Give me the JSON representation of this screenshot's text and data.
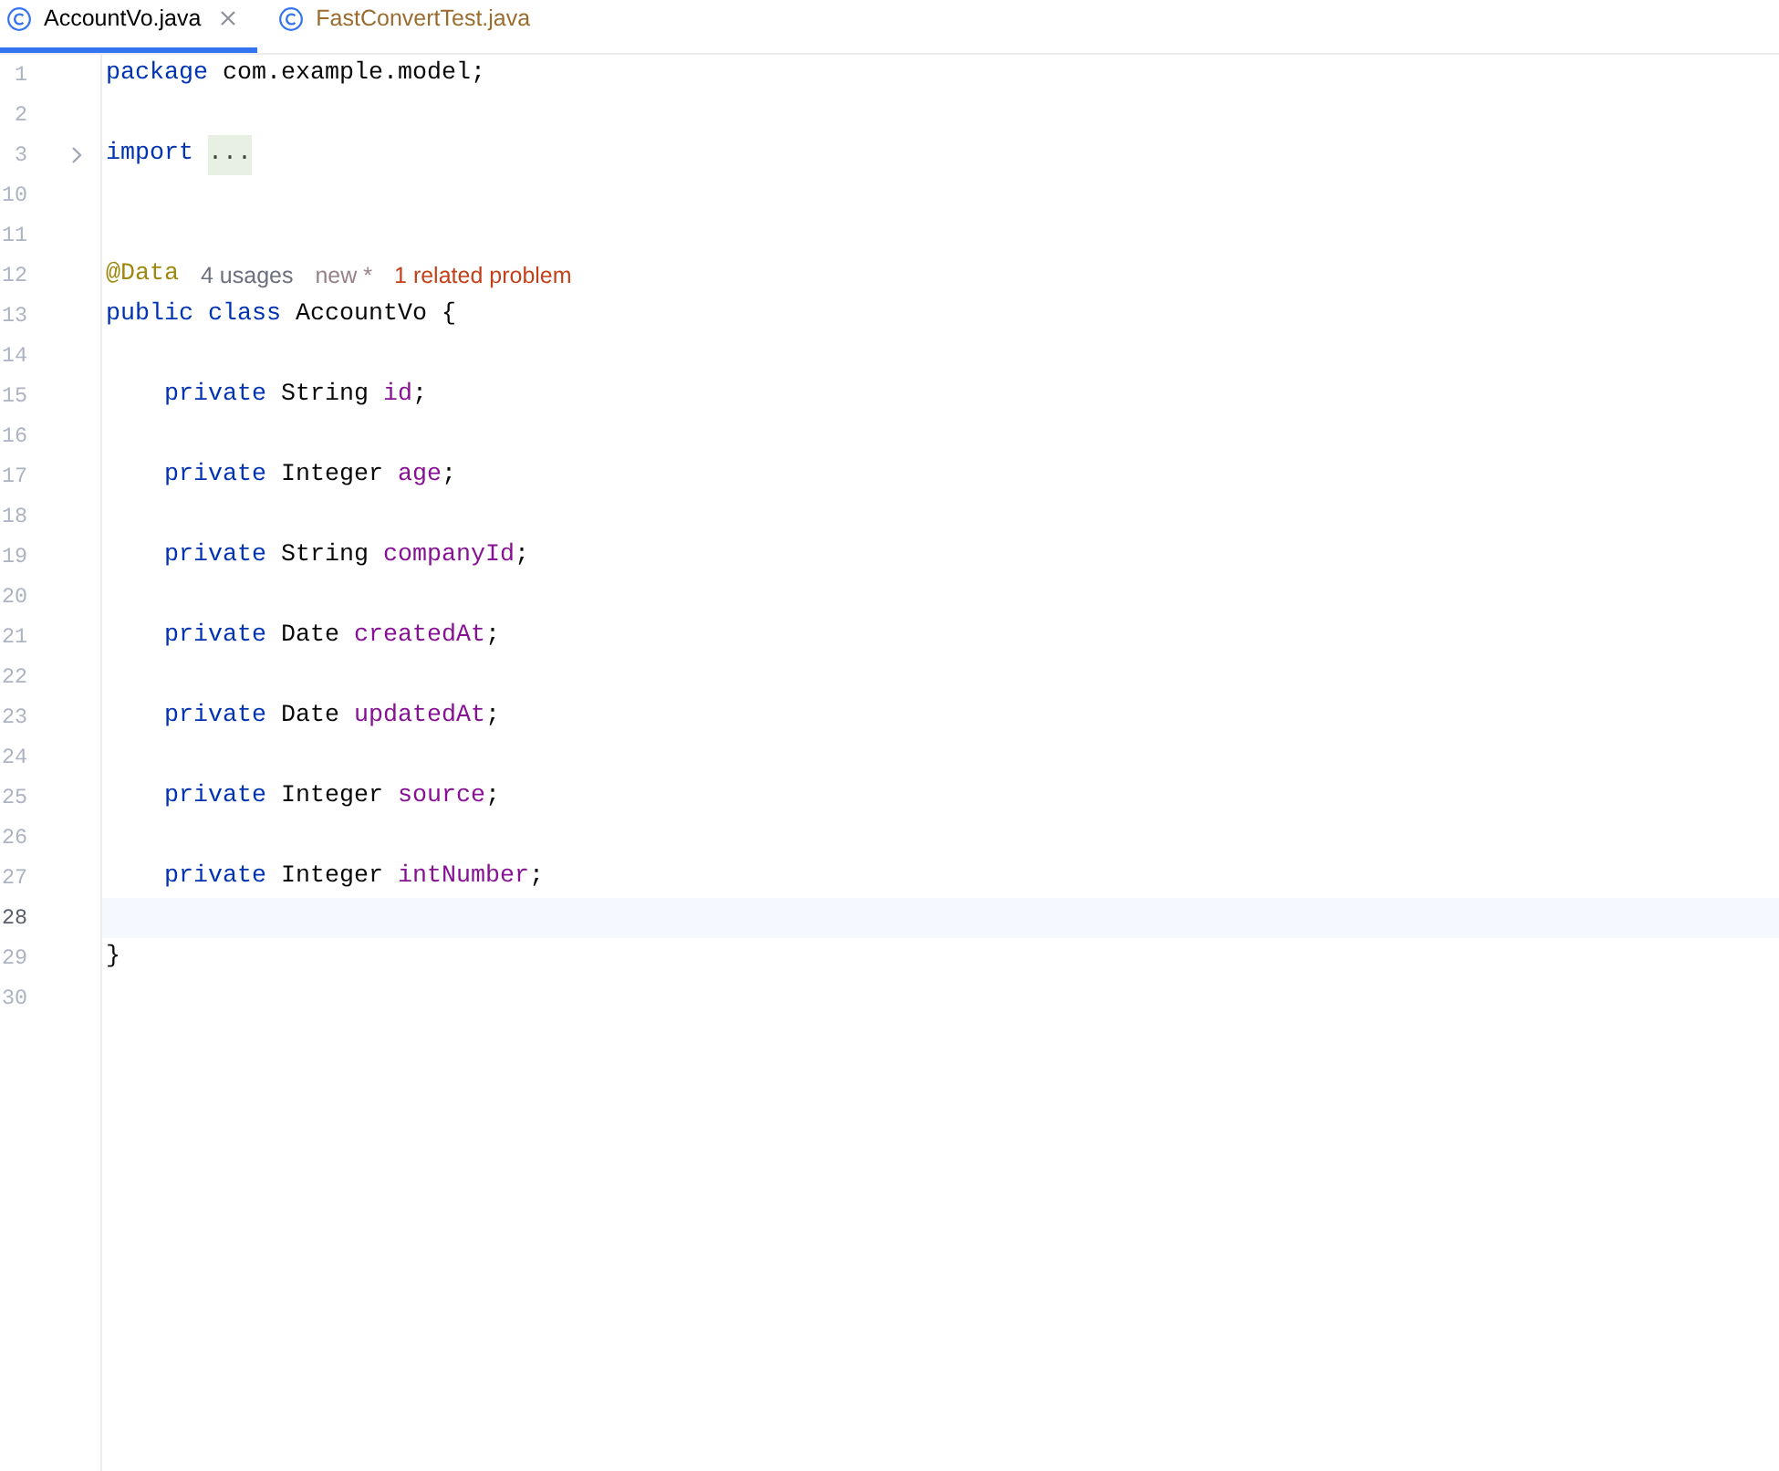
{
  "tabs": [
    {
      "label": "AccountVo.java",
      "selected": true,
      "color": "#000000"
    },
    {
      "label": "FastConvertTest.java",
      "selected": false,
      "color": "#9a6d2e"
    }
  ],
  "editor": {
    "lines": [
      {
        "number": "1",
        "current": false,
        "tokens": [
          {
            "kind": "keyword",
            "text": "package "
          },
          {
            "kind": "plain",
            "text": "com.example.model;"
          }
        ]
      },
      {
        "number": "2",
        "current": false
      },
      {
        "number": "3",
        "current": false,
        "tokens": [
          {
            "kind": "keyword",
            "text": "import"
          }
        ],
        "fold": {
          "placeholder": "...",
          "expanded": false
        }
      },
      {
        "number": "10",
        "current": false
      },
      {
        "number": "11",
        "current": false
      },
      {
        "number": "12",
        "current": false,
        "tokens": [
          {
            "kind": "annotation",
            "text": "@Data"
          }
        ],
        "hints": [
          {
            "kind": "usages",
            "text": "4 usages"
          },
          {
            "kind": "author",
            "text": "new *"
          },
          {
            "kind": "problem",
            "text": "1 related problem"
          }
        ]
      },
      {
        "number": "13",
        "current": false,
        "tokens": [
          {
            "kind": "keyword",
            "text": "public class "
          },
          {
            "kind": "plain",
            "text": "AccountVo {"
          }
        ],
        "children": [
          {
            "number": "14",
            "current": false
          },
          {
            "number": "15",
            "current": false,
            "tokens": [
              {
                "kind": "keyword",
                "text": "private "
              },
              {
                "kind": "plain",
                "text": "String "
              },
              {
                "kind": "field",
                "text": "id"
              },
              {
                "kind": "plain",
                "text": ";"
              }
            ]
          },
          {
            "number": "16",
            "current": false
          },
          {
            "number": "17",
            "current": false,
            "tokens": [
              {
                "kind": "keyword",
                "text": "private "
              },
              {
                "kind": "plain",
                "text": "Integer "
              },
              {
                "kind": "field",
                "text": "age"
              },
              {
                "kind": "plain",
                "text": ";"
              }
            ]
          },
          {
            "number": "18",
            "current": false
          },
          {
            "number": "19",
            "current": false,
            "tokens": [
              {
                "kind": "keyword",
                "text": "private "
              },
              {
                "kind": "plain",
                "text": "String "
              },
              {
                "kind": "field",
                "text": "companyId"
              },
              {
                "kind": "plain",
                "text": ";"
              }
            ]
          },
          {
            "number": "20",
            "current": false
          },
          {
            "number": "21",
            "current": false,
            "tokens": [
              {
                "kind": "keyword",
                "text": "private "
              },
              {
                "kind": "plain",
                "text": "Date "
              },
              {
                "kind": "field",
                "text": "createdAt"
              },
              {
                "kind": "plain",
                "text": ";"
              }
            ]
          },
          {
            "number": "22",
            "current": false
          },
          {
            "number": "23",
            "current": false,
            "tokens": [
              {
                "kind": "keyword",
                "text": "private "
              },
              {
                "kind": "plain",
                "text": "Date "
              },
              {
                "kind": "field",
                "text": "updatedAt"
              },
              {
                "kind": "plain",
                "text": ";"
              }
            ]
          },
          {
            "number": "24",
            "current": false
          },
          {
            "number": "25",
            "current": false,
            "tokens": [
              {
                "kind": "keyword",
                "text": "private "
              },
              {
                "kind": "plain",
                "text": "Integer "
              },
              {
                "kind": "field",
                "text": "source"
              },
              {
                "kind": "plain",
                "text": ";"
              }
            ]
          },
          {
            "number": "26",
            "current": false
          },
          {
            "number": "27",
            "current": false,
            "tokens": [
              {
                "kind": "keyword",
                "text": "private "
              },
              {
                "kind": "plain",
                "text": "Integer "
              },
              {
                "kind": "field",
                "text": "intNumber"
              },
              {
                "kind": "plain",
                "text": ";"
              }
            ]
          },
          {
            "number": "28",
            "current": true
          }
        ]
      },
      {
        "number": "29",
        "current": false,
        "tokens": [
          {
            "kind": "plain",
            "text": "}"
          }
        ]
      },
      {
        "number": "30",
        "current": false
      }
    ]
  }
}
